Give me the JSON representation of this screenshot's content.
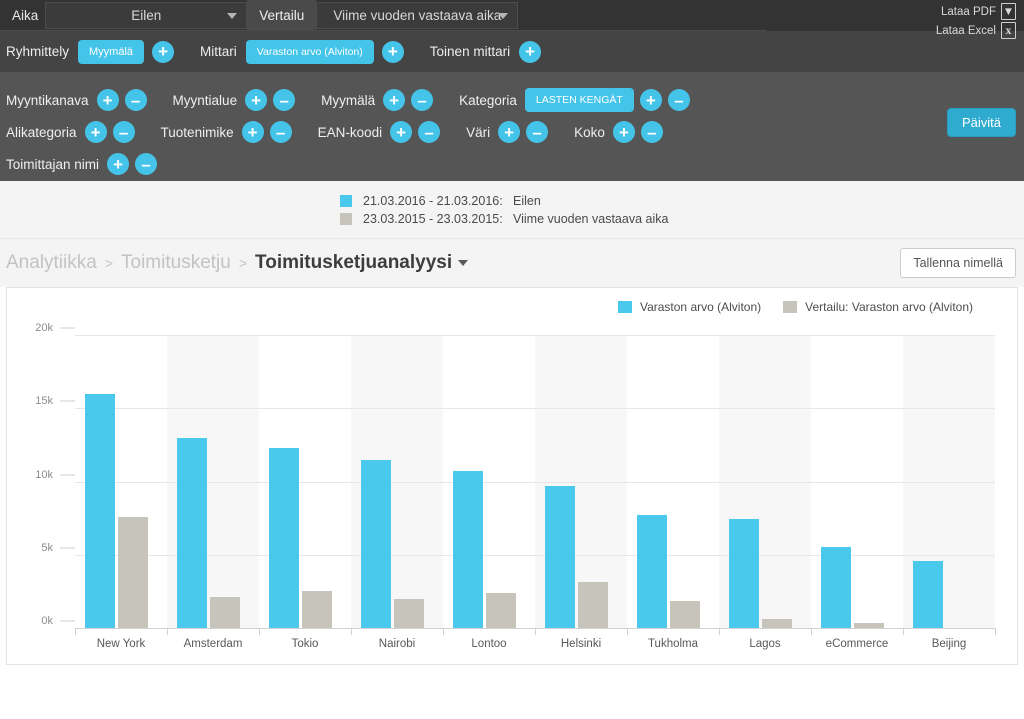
{
  "toolbar": {
    "time_label": "Aika",
    "time_value": "Eilen",
    "compare_tab": "Vertailu",
    "compare_value": "Viime vuoden vastaava aika",
    "download_pdf": "Lataa PDF",
    "download_pdf_icon": "pdf-file-icon",
    "download_excel": "Lataa Excel",
    "download_excel_icon": "excel-file-icon",
    "pdf_glyph": "⎇",
    "excel_glyph": "x"
  },
  "measures": {
    "grouping_label": "Ryhmittely",
    "grouping_chip": "Myymälä",
    "metric_label": "Mittari",
    "metric_chip": "Varaston arvo (Alviton)",
    "second_metric_label": "Toinen mittari",
    "add_glyph": "+",
    "remove_glyph": "–"
  },
  "filters": {
    "update_button": "Päivitä",
    "rows": [
      [
        {
          "label": "Myyntikanava",
          "chip": null
        },
        {
          "label": "Myyntialue",
          "chip": null
        },
        {
          "label": "Myymälä",
          "chip": null
        },
        {
          "label": "Kategoria",
          "chip": "LASTEN KENGÄT"
        }
      ],
      [
        {
          "label": "Alikategoria",
          "chip": null
        },
        {
          "label": "Tuotenimike",
          "chip": null
        },
        {
          "label": "EAN-koodi",
          "chip": null
        },
        {
          "label": "Väri",
          "chip": null
        },
        {
          "label": "Koko",
          "chip": null
        }
      ],
      [
        {
          "label": "Toimittajan nimi",
          "chip": null
        }
      ]
    ]
  },
  "comparison_legend": [
    {
      "range": "21.03.2016 - 21.03.2016:",
      "name": "Eilen",
      "color": "#4ac9ec"
    },
    {
      "range": "23.03.2015 - 23.03.2015:",
      "name": "Viime vuoden vastaava aika",
      "color": "#c6c4bb"
    }
  ],
  "breadcrumb": {
    "items": [
      "Analytiikka",
      "Toimitusketju",
      "Toimitusketjuanalyysi"
    ],
    "separator": ">",
    "save_as": "Tallenna nimellä",
    "caret_icon": "chevron-down-icon"
  },
  "chart_data": {
    "type": "bar",
    "title": "",
    "xlabel": "",
    "ylabel": "",
    "ylim": [
      0,
      20000
    ],
    "yticks": [
      0,
      5000,
      10000,
      15000,
      20000
    ],
    "ytick_labels": [
      "0k",
      "5k",
      "10k",
      "15k",
      "20k"
    ],
    "grid": true,
    "legend_position": "top-right",
    "categories": [
      "New York",
      "Amsterdam",
      "Tokio",
      "Nairobi",
      "Lontoo",
      "Helsinki",
      "Tukholma",
      "Lagos",
      "eCommerce",
      "Beijing"
    ],
    "series": [
      {
        "name": "Varaston arvo (Alviton)",
        "color": "#4ac9ec",
        "values": [
          16000,
          13000,
          12300,
          11500,
          10700,
          9700,
          7700,
          7450,
          5550,
          4600
        ]
      },
      {
        "name": "Vertailu: Varaston arvo (Alviton)",
        "color": "#c6c4bb",
        "values": [
          7550,
          2150,
          2550,
          1950,
          2400,
          3150,
          1850,
          600,
          350,
          0
        ]
      }
    ]
  }
}
